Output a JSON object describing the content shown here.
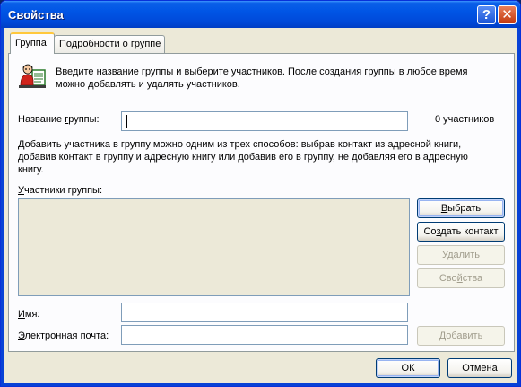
{
  "window": {
    "title": "Свойства",
    "help_label": "?",
    "close_label": "✕"
  },
  "tabs": [
    {
      "label": "Группа",
      "active": true
    },
    {
      "label": "Подробности о группе",
      "active": false
    }
  ],
  "intro": {
    "icon": "group-contacts-icon",
    "text_line1": "Введите название группы и выберите участников. После создания группы в любое время",
    "text_line2": "можно добавлять и удалять участников."
  },
  "group_name": {
    "label_pre": "Название ",
    "label_key": "г",
    "label_post": "руппы:",
    "value": "",
    "member_count": "0 участников"
  },
  "instructions": {
    "line1": "Добавить участника в группу можно одним из трех способов: выбрав контакт из адресной книги,",
    "line2": "добавив контакт в группу и адресную книгу или добавив его в группу, не добавляя его в адресную",
    "line3": "книгу."
  },
  "members": {
    "label_key": "У",
    "label_rest": "частники группы:",
    "items": []
  },
  "buttons": {
    "select": {
      "key": "В",
      "rest": "ыбрать"
    },
    "create_contact": {
      "pre": "Со",
      "key": "з",
      "rest": "дать контакт"
    },
    "delete": {
      "key": "У",
      "rest": "далить"
    },
    "properties": {
      "pre": "Сво",
      "key": "й",
      "rest": "ства"
    },
    "add": {
      "pre": "",
      "key": "Д",
      "rest": "обавить"
    },
    "ok": "ОК",
    "cancel": "Отмена"
  },
  "name_field": {
    "label_key": "И",
    "label_rest": "мя:",
    "value": ""
  },
  "email_field": {
    "label_key": "Э",
    "label_rest": "лектронная почта:",
    "value": ""
  },
  "colors": {
    "titlebar": "#0055e5",
    "dialog_bg": "#ece9d8",
    "tab_highlight": "#ffc83c",
    "field_border": "#7f9db9"
  }
}
